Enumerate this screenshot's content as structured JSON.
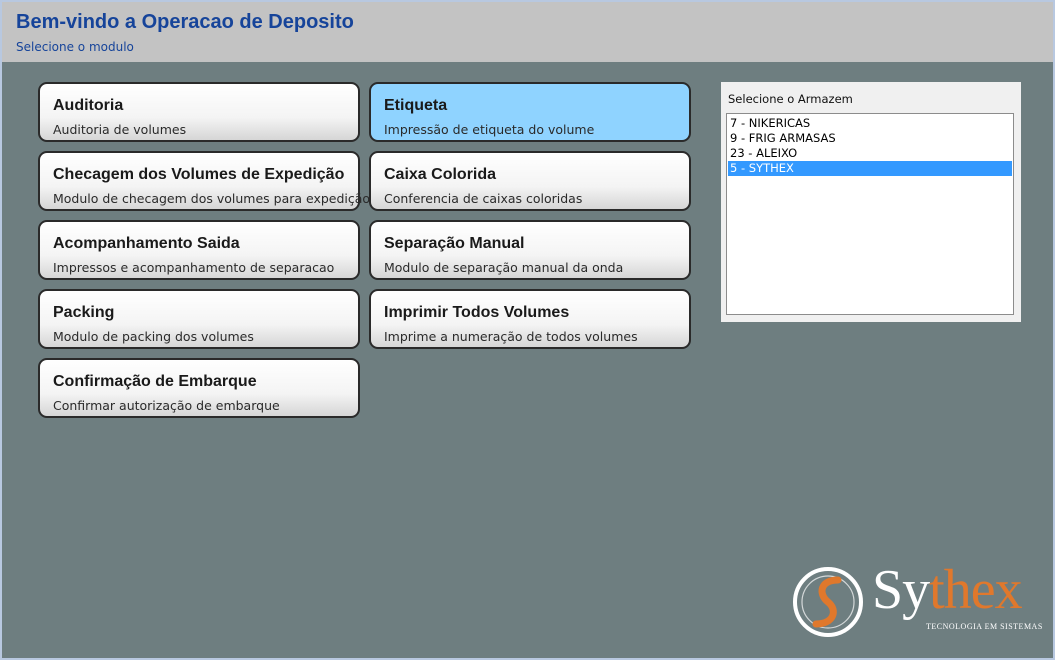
{
  "header": {
    "title": "Bem-vindo a Operacao de Deposito",
    "subtitle": "Selecione o modulo"
  },
  "modules": [
    {
      "title": "Auditoria",
      "description": "Auditoria de volumes"
    },
    {
      "title": "Etiqueta",
      "description": "Impressão de etiqueta do volume",
      "active": true
    },
    {
      "title": "Checagem dos Volumes de Expedição",
      "description": "Modulo de checagem dos volumes para expedição"
    },
    {
      "title": "Caixa Colorida",
      "description": "Conferencia de caixas coloridas"
    },
    {
      "title": "Acompanhamento Saida",
      "description": "Impressos e acompanhamento de separacao"
    },
    {
      "title": "Separação Manual",
      "description": "Modulo de separação manual da onda"
    },
    {
      "title": "Packing",
      "description": "Modulo de packing dos volumes"
    },
    {
      "title": "Imprimir Todos Volumes",
      "description": "Imprime a numeração de todos volumes"
    },
    {
      "title": "Confirmação de Embarque",
      "description": "Confirmar autorização de embarque"
    }
  ],
  "armazem": {
    "label": "Selecione o Armazem",
    "options": [
      "7 - NIKERICAS",
      "9 - FRIG ARMASAS",
      "23 - ALEIXO",
      "5 - SYTHEX"
    ],
    "selected": "5 - SYTHEX"
  },
  "logo": {
    "name_part1": "Sy",
    "name_part2": "thex",
    "tagline": "TECNOLOGIA EM SISTEMAS"
  },
  "colors": {
    "background": "#6e7e80",
    "header": "#c3c3c3",
    "title": "#16449a",
    "active_tile": "#8fd3ff",
    "selection": "#3399ff",
    "logo_accent": "#e0782c"
  }
}
